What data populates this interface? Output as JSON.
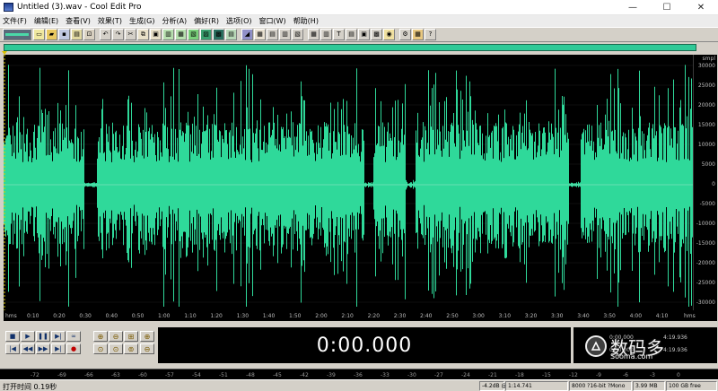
{
  "window": {
    "title": "Untitled (3).wav - Cool Edit Pro",
    "minimize_glyph": "—",
    "maximize_glyph": "☐",
    "close_glyph": "✕"
  },
  "menu": [
    "文件(F)",
    "编辑(E)",
    "查看(V)",
    "效果(T)",
    "生成(G)",
    "分析(A)",
    "偏好(R)",
    "选项(O)",
    "窗口(W)",
    "帮助(H)"
  ],
  "waveform": {
    "color": "#2fd99a",
    "background": "#000000",
    "amplitude_unit": "smpl",
    "amplitude_labels": [
      "30000",
      "25000",
      "20000",
      "15000",
      "10000",
      "5000",
      "0",
      "-5000",
      "-10000",
      "-15000",
      "-20000",
      "-25000",
      "-30000"
    ]
  },
  "time_ruler": {
    "unit_left": "hms",
    "unit_right": "hms",
    "labels": [
      "0:10",
      "0:20",
      "0:30",
      "0:40",
      "0:50",
      "1:00",
      "1:10",
      "1:20",
      "1:30",
      "1:40",
      "1:50",
      "2:00",
      "2:10",
      "2:20",
      "2:30",
      "2:40",
      "2:50",
      "3:00",
      "3:10",
      "3:20",
      "3:30",
      "3:40",
      "3:50",
      "4:00",
      "4:10"
    ]
  },
  "transport": {
    "time_display": "0:00.000"
  },
  "selection_panel": {
    "begin_value": "0:00.000",
    "end_value": "4:19.936",
    "row2_value": "0:00.000",
    "row2_end": "4:19.936"
  },
  "level_meter": {
    "labels": [
      "-72",
      "-69",
      "-66",
      "-63",
      "-60",
      "-57",
      "-54",
      "-51",
      "-48",
      "-45",
      "-42",
      "-39",
      "-36",
      "-33",
      "-30",
      "-27",
      "-24",
      "-21",
      "-18",
      "-15",
      "-12",
      "-9",
      "-6",
      "-3",
      "0"
    ]
  },
  "statusbar": {
    "left": "打开时间 0.19秒",
    "db": "-4.2dB @",
    "position": "1:14.741",
    "format": "8000 ?16-bit ?Mono",
    "size": "3.99 MB",
    "free": "100 GB free"
  },
  "watermark": {
    "zh": "数码多",
    "en": "Sooma.com"
  }
}
